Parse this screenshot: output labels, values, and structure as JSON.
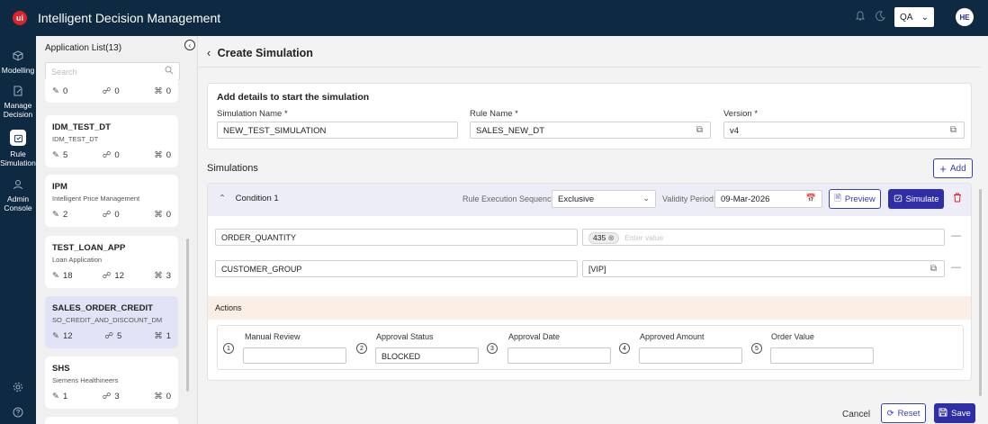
{
  "topbar": {
    "logo_letter": "ui",
    "title": "Intelligent Decision Management",
    "env_value": "QA",
    "avatar_initials": "HE"
  },
  "nav": {
    "items": [
      {
        "label": "Modelling",
        "icon": "cube-icon"
      },
      {
        "label": "Manage Decision",
        "icon": "edit-document-icon"
      },
      {
        "label": "Rule Simulation",
        "icon": "simulation-icon"
      },
      {
        "label": "Admin Console",
        "icon": "admin-icon"
      }
    ]
  },
  "applist": {
    "title": "Application List(13)",
    "search_placeholder": "Search",
    "cards": [
      {
        "name": "",
        "sub": "",
        "rules": "0",
        "flows": "0",
        "models": "0"
      },
      {
        "name": "IDM_TEST_DT",
        "sub": "IDM_TEST_DT",
        "rules": "5",
        "flows": "0",
        "models": "0"
      },
      {
        "name": "IPM",
        "sub": "Intelligent Price Management",
        "rules": "2",
        "flows": "0",
        "models": "0"
      },
      {
        "name": "TEST_LOAN_APP",
        "sub": "Loan Application",
        "rules": "18",
        "flows": "12",
        "models": "3"
      },
      {
        "name": "SALES_ORDER_CREDIT",
        "sub": "SO_CREDIT_AND_DISCOUNT_DM",
        "rules": "12",
        "flows": "5",
        "models": "1"
      },
      {
        "name": "SHS",
        "sub": "Siemens Healthineers",
        "rules": "1",
        "flows": "3",
        "models": "0"
      }
    ]
  },
  "main": {
    "title": "Create Simulation",
    "details": {
      "heading": "Add details to start the simulation",
      "sim_name_label": "Simulation Name *",
      "sim_name_value": "NEW_TEST_SIMULATION",
      "rule_name_label": "Rule Name *",
      "rule_name_value": "SALES_NEW_DT",
      "version_label": "Version *",
      "version_value": "v4"
    },
    "simulations_label": "Simulations",
    "add_label": "Add",
    "condition": {
      "title": "Condition 1",
      "res_label": "Rule Execution Sequence:",
      "res_value": "Exclusive",
      "validity_label": "Validity Period:",
      "validity_value": "09-Mar-2026",
      "preview_label": "Preview",
      "simulate_label": "Simulate"
    },
    "rules": [
      {
        "field": "ORDER_QUANTITY",
        "chip": "435",
        "placeholder": "Enter value"
      },
      {
        "field": "CUSTOMER_GROUP",
        "value": "[VIP]"
      }
    ],
    "actions": {
      "label": "Actions",
      "items": [
        {
          "num": "1",
          "label": "Manual Review",
          "value": ""
        },
        {
          "num": "2",
          "label": "Approval Status",
          "value": "BLOCKED"
        },
        {
          "num": "3",
          "label": "Approval Date",
          "value": ""
        },
        {
          "num": "4",
          "label": "Approved Amount",
          "value": ""
        },
        {
          "num": "5",
          "label": "Order Value",
          "value": ""
        }
      ]
    },
    "footer": {
      "cancel": "Cancel",
      "reset": "Reset",
      "save": "Save"
    }
  },
  "colors": {
    "topbar": "#0e2942",
    "primary": "#2e2fa4",
    "danger": "#d9252a",
    "condition_bar": "#ecedf7",
    "actions_bar": "#fbefe5",
    "selected_card": "#e1e4f6"
  }
}
